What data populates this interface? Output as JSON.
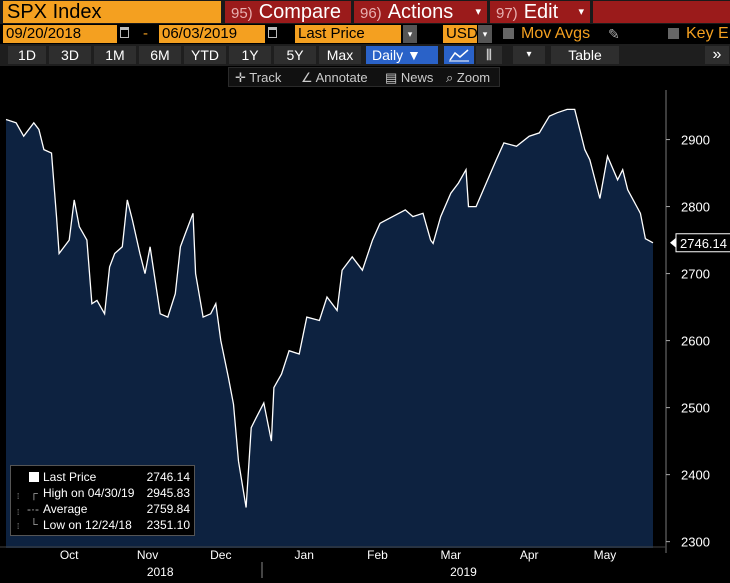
{
  "header": {
    "ticker": "SPX Index",
    "menu": [
      {
        "num": "95)",
        "label": "Compare"
      },
      {
        "num": "96)",
        "label": "Actions"
      },
      {
        "num": "97)",
        "label": "Edit"
      }
    ],
    "dropdown_glyph": "▾"
  },
  "params": {
    "start_date": "09/20/2018",
    "separator": "-",
    "end_date": "06/03/2019",
    "field": "Last Price",
    "currency": "USD",
    "mov_avgs_label": "Mov Avgs",
    "key_events_label": "Key E",
    "edit_glyph": "✎"
  },
  "toolbar": {
    "ranges": [
      "1D",
      "3D",
      "1M",
      "6M",
      "YTD",
      "1Y",
      "5Y",
      "Max"
    ],
    "frequency": "Daily ▼",
    "table_label": "Table",
    "more_glyph": "»",
    "chart_glyph": "⫼",
    "dd_glyph": "▾"
  },
  "tools": [
    {
      "icon": "✛",
      "label": "Track"
    },
    {
      "icon": "∠",
      "label": "Annotate"
    },
    {
      "icon": "▤",
      "label": "News"
    },
    {
      "icon": "⌕",
      "label": "Zoom"
    }
  ],
  "legend": {
    "rows": [
      {
        "label": "Last Price",
        "value": "2746.14"
      },
      {
        "label": "High on 04/30/19",
        "value": "2945.83"
      },
      {
        "label": "Average",
        "value": "2759.84"
      },
      {
        "label": "Low on 12/24/18",
        "value": "2351.10"
      }
    ]
  },
  "colors": {
    "brand_orange": "#f4a020",
    "menu_red": "#9b1b1b",
    "chart_fill": "#0d2240",
    "line": "#ffffff",
    "selected_blue": "#2a62c8"
  },
  "chart_data": {
    "type": "area",
    "series": [
      {
        "name": "Last Price",
        "x": [
          "2018-09-20",
          "2018-09-24",
          "2018-09-27",
          "2018-10-01",
          "2018-10-03",
          "2018-10-05",
          "2018-10-08",
          "2018-10-10",
          "2018-10-11",
          "2018-10-15",
          "2018-10-17",
          "2018-10-19",
          "2018-10-22",
          "2018-10-24",
          "2018-10-26",
          "2018-10-29",
          "2018-10-31",
          "2018-11-02",
          "2018-11-05",
          "2018-11-07",
          "2018-11-09",
          "2018-11-12",
          "2018-11-14",
          "2018-11-16",
          "2018-11-20",
          "2018-11-23",
          "2018-11-26",
          "2018-11-28",
          "2018-11-30",
          "2018-12-03",
          "2018-12-04",
          "2018-12-07",
          "2018-12-10",
          "2018-12-12",
          "2018-12-14",
          "2018-12-17",
          "2018-12-19",
          "2018-12-21",
          "2018-12-24",
          "2018-12-26",
          "2018-12-28",
          "2018-12-31",
          "2019-01-03",
          "2019-01-04",
          "2019-01-07",
          "2019-01-10",
          "2019-01-14",
          "2019-01-17",
          "2019-01-22",
          "2019-01-25",
          "2019-01-29",
          "2019-01-31",
          "2019-02-04",
          "2019-02-08",
          "2019-02-12",
          "2019-02-15",
          "2019-02-20",
          "2019-02-25",
          "2019-02-28",
          "2019-03-04",
          "2019-03-07",
          "2019-03-08",
          "2019-03-11",
          "2019-03-15",
          "2019-03-18",
          "2019-03-21",
          "2019-03-22",
          "2019-03-25",
          "2019-03-29",
          "2019-04-02",
          "2019-04-05",
          "2019-04-10",
          "2019-04-15",
          "2019-04-19",
          "2019-04-23",
          "2019-04-26",
          "2019-04-30",
          "2019-05-03",
          "2019-05-07",
          "2019-05-09",
          "2019-05-13",
          "2019-05-16",
          "2019-05-20",
          "2019-05-22",
          "2019-05-24",
          "2019-05-29",
          "2019-05-31",
          "2019-06-03"
        ],
        "y": [
          2930,
          2925,
          2905,
          2925,
          2915,
          2885,
          2880,
          2785,
          2730,
          2750,
          2810,
          2770,
          2750,
          2655,
          2660,
          2640,
          2710,
          2730,
          2740,
          2810,
          2780,
          2730,
          2700,
          2740,
          2640,
          2635,
          2670,
          2740,
          2760,
          2790,
          2700,
          2635,
          2640,
          2655,
          2600,
          2545,
          2505,
          2420,
          2351,
          2470,
          2485,
          2507,
          2450,
          2530,
          2550,
          2585,
          2580,
          2635,
          2630,
          2665,
          2645,
          2705,
          2725,
          2705,
          2750,
          2775,
          2785,
          2795,
          2785,
          2790,
          2750,
          2745,
          2785,
          2820,
          2835,
          2855,
          2800,
          2800,
          2835,
          2870,
          2895,
          2890,
          2905,
          2910,
          2935,
          2940,
          2945,
          2945,
          2885,
          2870,
          2812,
          2875,
          2840,
          2855,
          2825,
          2790,
          2752,
          2746
        ]
      }
    ],
    "ylim": [
      2295,
      2965
    ],
    "yticks": [
      2300,
      2400,
      2500,
      2600,
      2700,
      2800,
      2900
    ],
    "xticks": [
      {
        "date": "2018-10-15",
        "label": "Oct"
      },
      {
        "date": "2018-11-15",
        "label": "Nov"
      },
      {
        "date": "2018-12-14",
        "label": "Dec"
      },
      {
        "date": "2019-01-16",
        "label": "Jan"
      },
      {
        "date": "2019-02-14",
        "label": "Feb"
      },
      {
        "date": "2019-03-15",
        "label": "Mar"
      },
      {
        "date": "2019-04-15",
        "label": "Apr"
      },
      {
        "date": "2019-05-15",
        "label": "May"
      }
    ],
    "year_labels": [
      {
        "date": "2018-11-20",
        "label": "2018"
      },
      {
        "date": "2019-03-20",
        "label": "2019"
      }
    ],
    "last_value_label": "2746.14",
    "grid": false
  }
}
